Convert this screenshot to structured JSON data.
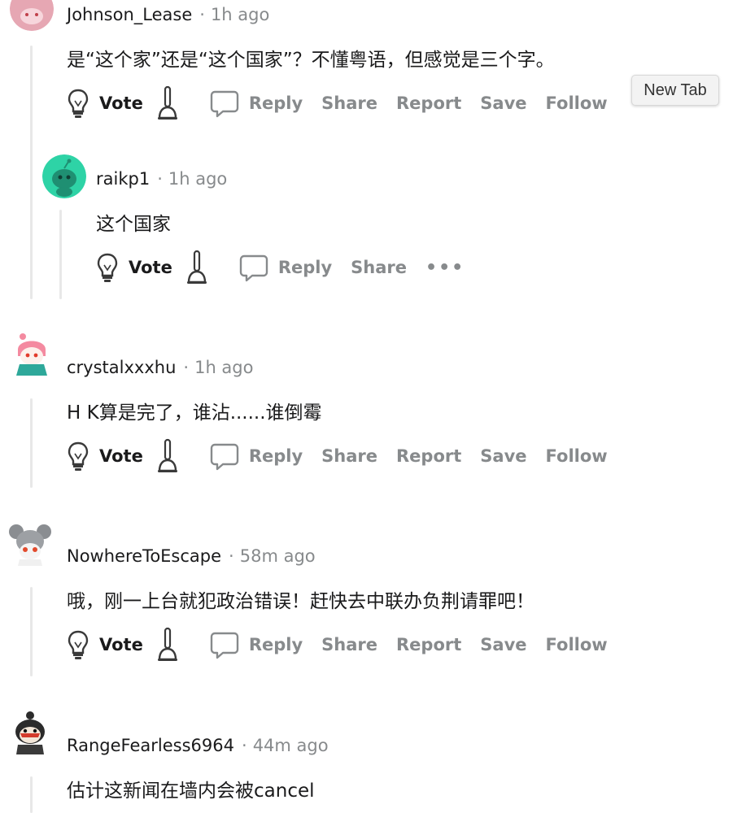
{
  "tooltip": {
    "label": "New Tab"
  },
  "actions": {
    "vote": "Vote",
    "reply": "Reply",
    "share": "Share",
    "report": "Report",
    "save": "Save",
    "follow": "Follow",
    "more": "•••"
  },
  "comments": [
    {
      "username": "Johnson_Lease",
      "separator": "·",
      "time": "1h ago",
      "body": "是“这个家”还是“这个国家”？不懂粤语，但感觉是三个字。",
      "avatar_color": "#e6a7b3"
    },
    {
      "username": "raikp1",
      "separator": "·",
      "time": "1h ago",
      "body": "这个国家",
      "avatar_color": "#2ed3a6"
    },
    {
      "username": "crystalxxxhu",
      "separator": "·",
      "time": "1h ago",
      "body": "H K算是完了，谁沾......谁倒霉",
      "avatar_color": "#f48aa0"
    },
    {
      "username": "NowhereToEscape",
      "separator": "·",
      "time": "58m ago",
      "body": "哦，刚一上台就犯政治错误！赶快去中联办负荆请罪吧！",
      "avatar_color": "#8a8d91"
    },
    {
      "username": "RangeFearless6964",
      "separator": "·",
      "time": "44m ago",
      "body": "估计这新闻在墙内会被cancel",
      "avatar_color": "#2b2b2b"
    }
  ],
  "colors": {
    "text": "#1a1a1b",
    "muted": "#878a8c",
    "thread_line": "#e8e8e8"
  },
  "icons": [
    "upvote-lightbulb-icon",
    "downvote-plunger-icon",
    "reply-bubble-icon",
    "more-dots-icon"
  ]
}
